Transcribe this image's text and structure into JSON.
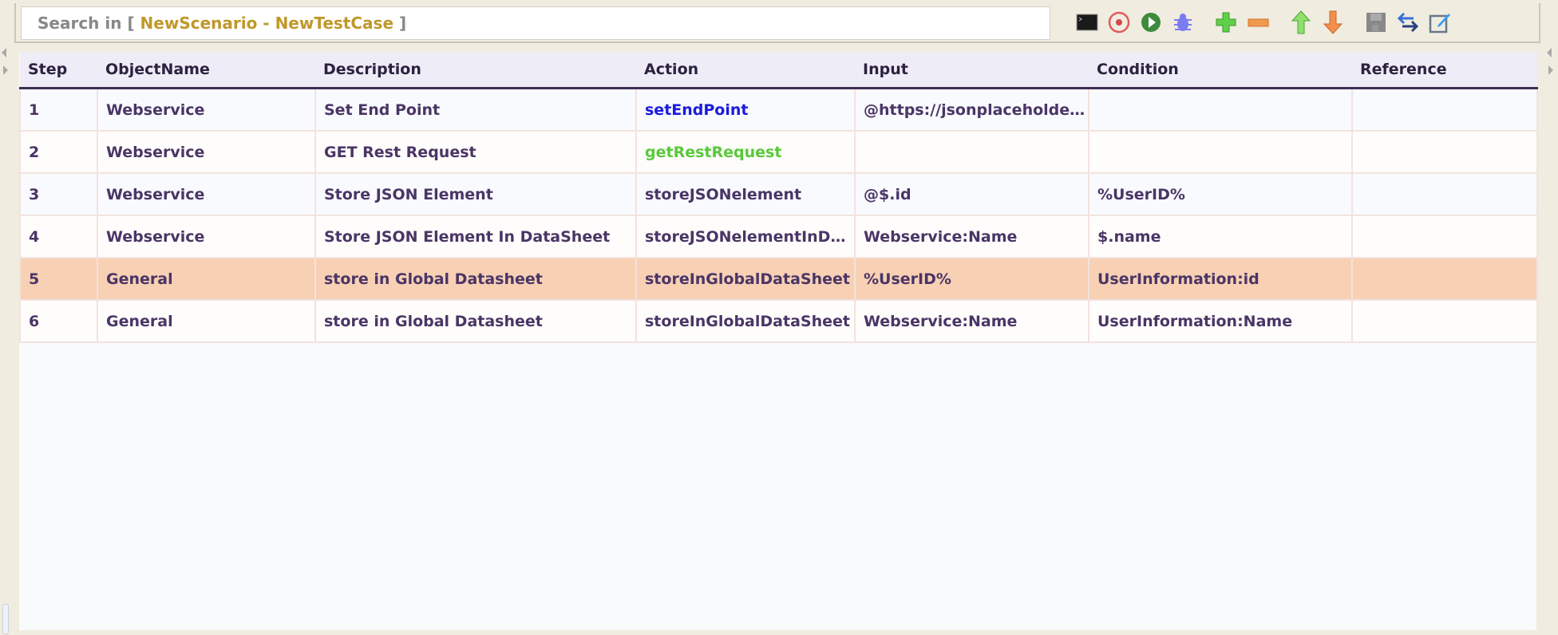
{
  "search": {
    "prefix": "Search in [ ",
    "scope": "NewScenario - NewTestCase",
    "suffix": " ]"
  },
  "toolbar": [
    "console-icon",
    "record-icon",
    "run-icon",
    "debug-icon",
    "add-step-icon",
    "remove-step-icon",
    "move-up-icon",
    "move-down-icon",
    "save-icon",
    "replace-icon",
    "edit-icon"
  ],
  "colors": {
    "setEndPoint": "#1a1adf",
    "getRestRequest": "#58c93a",
    "selected_row": "#f8d0b4"
  },
  "table": {
    "headers": [
      "Step",
      "ObjectName",
      "Description",
      "Action",
      "Input",
      "Condition",
      "Reference"
    ],
    "rows": [
      [
        "1",
        "Webservice",
        "Set End Point",
        "setEndPoint",
        "@https://jsonplaceholder....",
        "",
        ""
      ],
      [
        "2",
        "Webservice",
        "GET Rest Request",
        "getRestRequest",
        "",
        "",
        ""
      ],
      [
        "3",
        "Webservice",
        "Store JSON Element",
        "storeJSONelement",
        "@$.id",
        "%UserID%",
        ""
      ],
      [
        "4",
        "Webservice",
        "Store JSON Element In DataSheet",
        "storeJSONelementInDa...",
        "Webservice:Name",
        "$.name",
        ""
      ],
      [
        "5",
        "General",
        "store in Global Datasheet",
        "storeInGlobalDataSheet",
        "%UserID%",
        "UserInformation:id",
        ""
      ],
      [
        "6",
        "General",
        "store in Global Datasheet",
        "storeInGlobalDataSheet",
        "Webservice:Name",
        "UserInformation:Name",
        ""
      ]
    ]
  }
}
